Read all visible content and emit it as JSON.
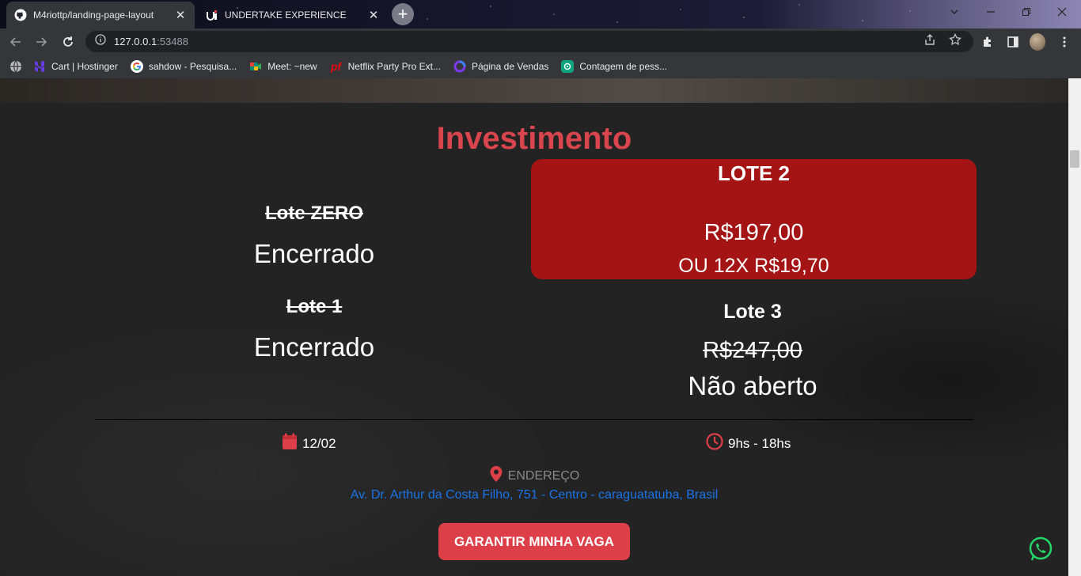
{
  "browser": {
    "tabs": [
      {
        "title": "M4riottp/landing-page-layout",
        "icon": "github-icon",
        "active": true
      },
      {
        "title": "UNDERTAKE EXPERIENCE",
        "icon": "site-logo-icon",
        "active": false
      }
    ],
    "url_host": "127.0.0.1",
    "url_port": ":53488",
    "bookmarks": [
      {
        "label": "Cart | Hostinger",
        "icon": "hostinger-icon",
        "color": "#673de6"
      },
      {
        "label": "sahdow - Pesquisa...",
        "icon": "google-icon",
        "color": "#4285f4"
      },
      {
        "label": "Meet: ~new",
        "icon": "meet-icon",
        "color": "#00897b"
      },
      {
        "label": "Netflix Party Pro Ext...",
        "icon": "netflix-party-icon",
        "color": "#e50914"
      },
      {
        "label": "Página de Vendas",
        "icon": "sales-page-icon",
        "color": "#7c3aed"
      },
      {
        "label": "Contagem de pess...",
        "icon": "chatgpt-icon",
        "color": "#10a37f"
      }
    ]
  },
  "page": {
    "section_title": "Investimento",
    "lots": {
      "zero": {
        "name": "Lote ZERO",
        "status": "Encerrado"
      },
      "one": {
        "name": "Lote 1",
        "status": "Encerrado"
      },
      "two": {
        "name": "LOTE 2",
        "price": "R$197,00",
        "installments": "OU 12X R$19,70"
      },
      "three": {
        "name": "Lote 3",
        "price": "R$247,00",
        "status": "Não aberto"
      }
    },
    "date": "12/02",
    "time": "9hs - 18hs",
    "address_label": "ENDEREÇO",
    "address": "Av. Dr. Arthur da Costa Filho, 751 - Centro - caraguatatuba, Brasil",
    "cta_label": "GARANTIR MINHA VAGA"
  },
  "colors": {
    "accent_red": "#dc3f47",
    "card_red": "#a51414",
    "title_red": "#d9454c",
    "link_blue": "#1a73e8",
    "whatsapp_green": "#25d366"
  }
}
